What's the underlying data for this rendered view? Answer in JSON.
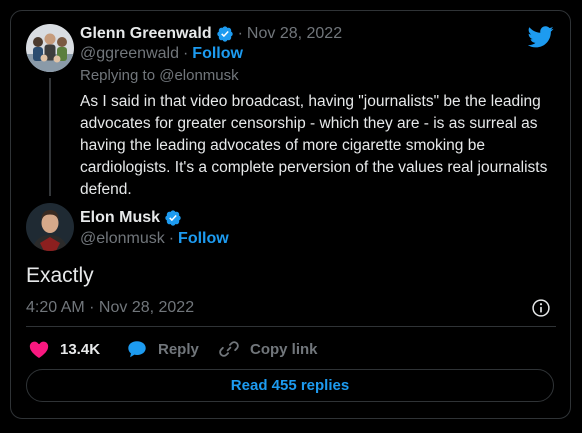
{
  "parent_tweet": {
    "author_name": "Glenn Greenwald",
    "handle": "@ggreenwald",
    "separator": "·",
    "follow_label": "Follow",
    "date": "Nov 28, 2022",
    "replying_to": "Replying to @elonmusk",
    "text": "As I said in that video broadcast, having \"journalists\" be the leading advocates for greater censorship - which they are - is as surreal as having the leading advocates of more cigarette smoking be cardiologists. It's a complete perversion of the values real journalists defend."
  },
  "main_tweet": {
    "author_name": "Elon Musk",
    "handle": "@elonmusk",
    "separator": "·",
    "follow_label": "Follow",
    "text": "Exactly",
    "timestamp": "4:20 AM · Nov 28, 2022"
  },
  "actions": {
    "like_count": "13.4K",
    "reply_label": "Reply",
    "copy_link_label": "Copy link"
  },
  "read_replies_label": "Read 455 replies",
  "icons": {
    "brand": "twitter-bird-icon",
    "verified": "verified-badge-icon",
    "info": "info-icon",
    "like": "heart-icon",
    "reply": "speech-bubble-icon",
    "copy": "link-icon"
  },
  "colors": {
    "background": "#000000",
    "text": "#e7e9ea",
    "muted": "#71767b",
    "accent": "#1d9bf0",
    "like": "#f91880",
    "border": "#2f3336"
  }
}
